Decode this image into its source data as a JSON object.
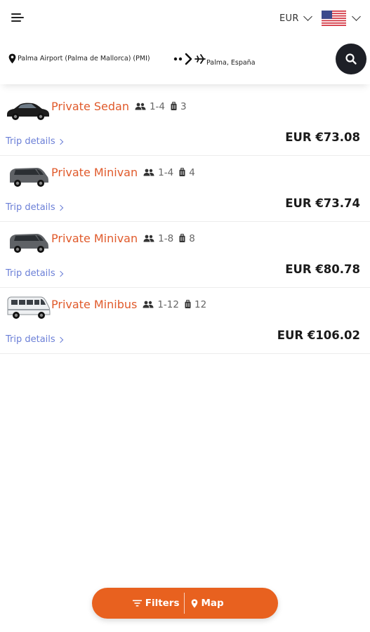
{
  "header": {
    "currency": "EUR",
    "language_flag": "us-flag-icon"
  },
  "search": {
    "origin": "Palma Airport (Palma de Mallorca) (PMI)",
    "destination": "Palma, España",
    "search_icon": "search-icon"
  },
  "results": [
    {
      "vehicle": "Private Sedan",
      "passengers": "1-4",
      "luggage": "3",
      "trip_details": "Trip details",
      "price": "EUR €73.08",
      "image": "sedan"
    },
    {
      "vehicle": "Private Minivan",
      "passengers": "1-4",
      "luggage": "4",
      "trip_details": "Trip details",
      "price": "EUR €73.74",
      "image": "minivan"
    },
    {
      "vehicle": "Private Minivan",
      "passengers": "1-8",
      "luggage": "8",
      "trip_details": "Trip details",
      "price": "EUR €80.78",
      "image": "minivan"
    },
    {
      "vehicle": "Private Minibus",
      "passengers": "1-12",
      "luggage": "12",
      "trip_details": "Trip details",
      "price": "EUR €106.02",
      "image": "minibus"
    }
  ],
  "bottom_bar": {
    "filters_label": "Filters",
    "map_label": "Map"
  },
  "colors": {
    "accent": "#e8611f",
    "vehicle_name": "#e05a2b",
    "link": "#6b7fd7",
    "search_button": "#1d1f26"
  }
}
